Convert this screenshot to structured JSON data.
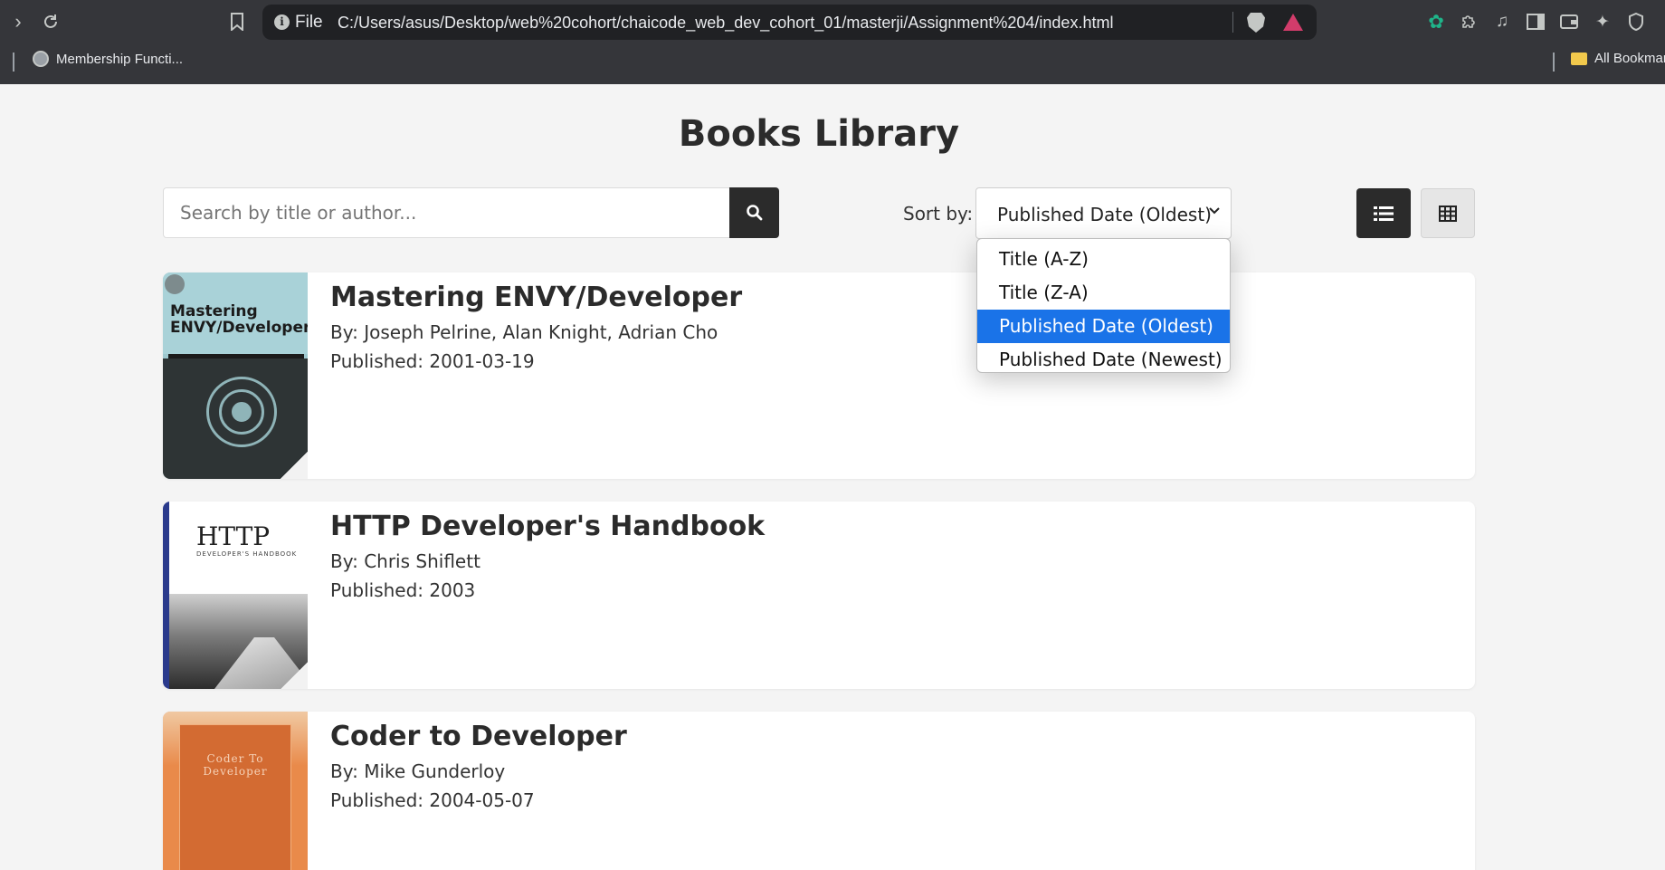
{
  "browser": {
    "scheme_label": "File",
    "url": "C:/Users/asus/Desktop/web%20cohort/chaicode_web_dev_cohort_01/masterji/Assignment%204/index.html",
    "bookmarks": [
      {
        "label": "Membership Functi...",
        "icon": "globe-icon"
      },
      {
        "label": "All Bookmarks",
        "icon": "folder-icon"
      }
    ]
  },
  "page": {
    "title": "Books Library"
  },
  "search": {
    "placeholder": "Search by title or author...",
    "value": ""
  },
  "sort": {
    "label": "Sort by:",
    "selected": "Published Date (Oldest)",
    "options": [
      "Title (A-Z)",
      "Title (Z-A)",
      "Published Date (Oldest)",
      "Published Date (Newest)"
    ]
  },
  "view": {
    "active": "list"
  },
  "books": [
    {
      "title": "Mastering ENVY/Developer",
      "authors": "By: Joseph Pelrine, Alan Knight, Adrian Cho",
      "published": "Published: 2001-03-19",
      "cover_title": "Mastering ENVY/Developer"
    },
    {
      "title": "HTTP Developer's Handbook",
      "authors": "By: Chris Shiflett",
      "published": "Published: 2003",
      "cover_title": "HTTP",
      "cover_subtitle": "DEVELOPER'S HANDBOOK"
    },
    {
      "title": "Coder to Developer",
      "authors": "By: Mike Gunderloy",
      "published": "Published: 2004-05-07",
      "cover_title": "Coder To Developer"
    }
  ],
  "colors": {
    "accent_dark": "#2b2b2b",
    "selection_blue": "#1a73e8",
    "page_bg": "#f4f4f4"
  }
}
